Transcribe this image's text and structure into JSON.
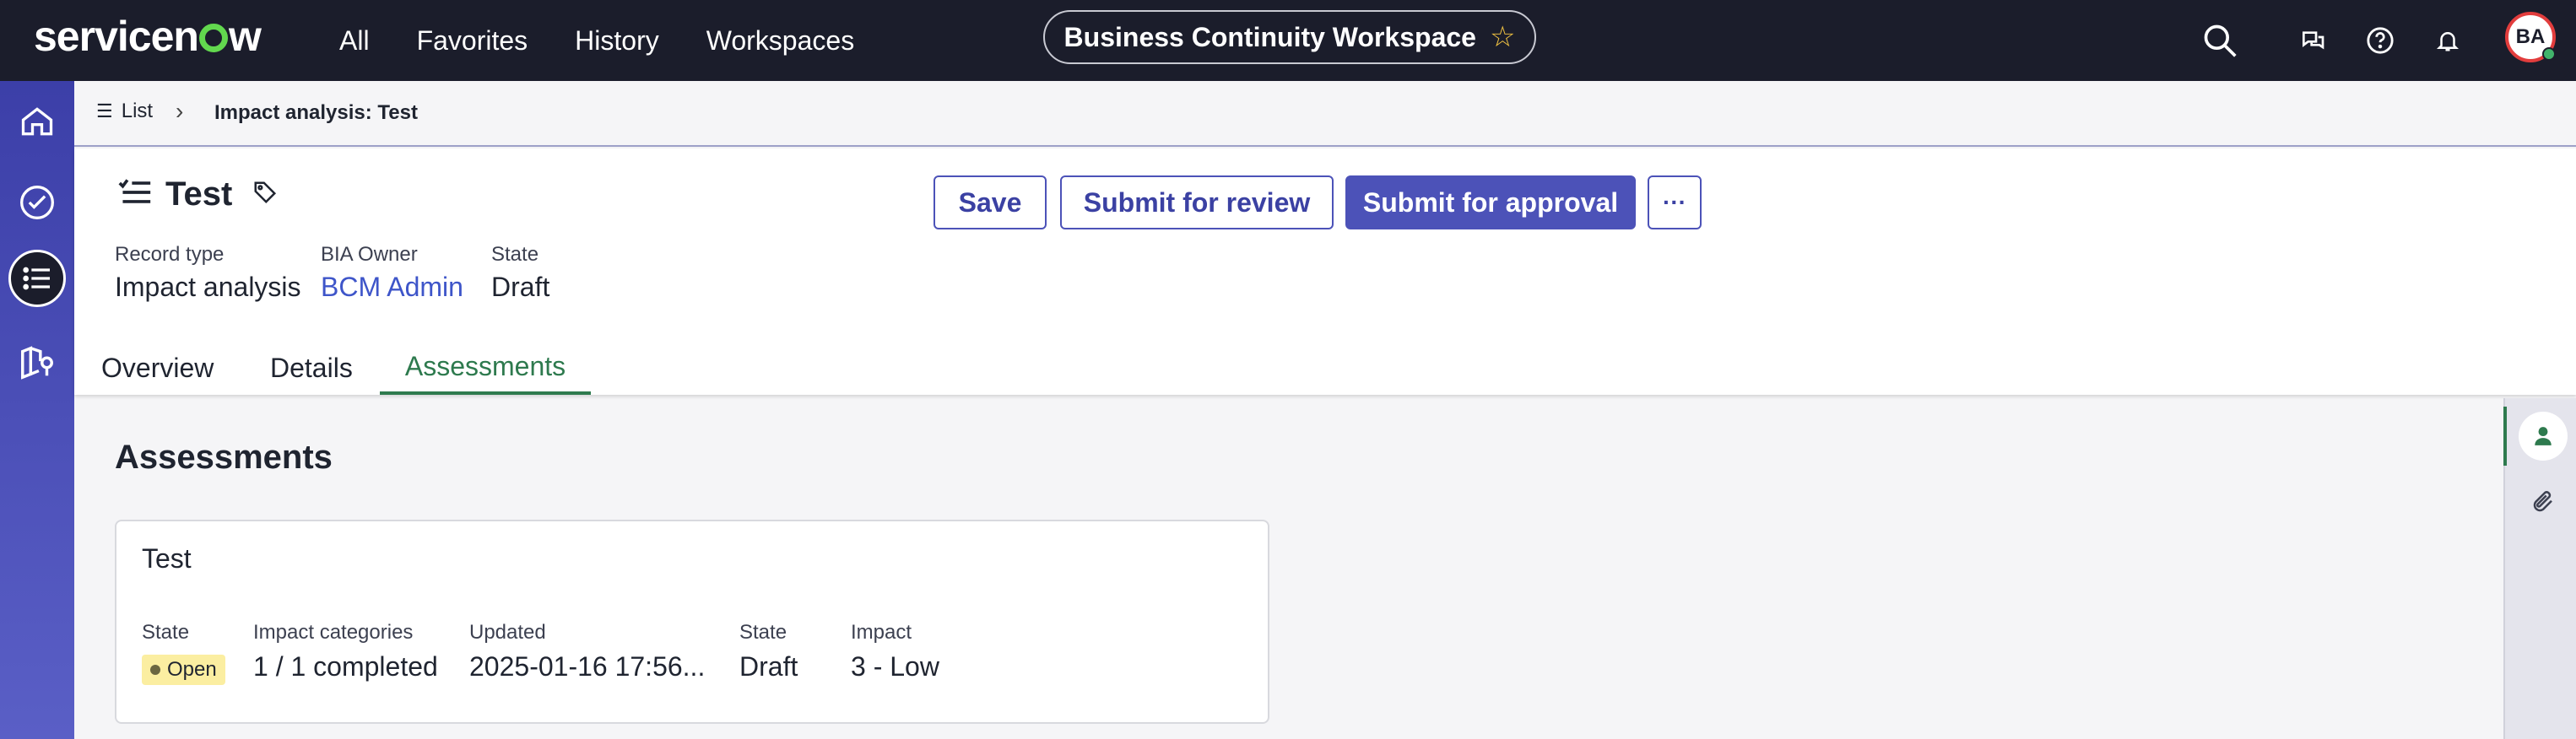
{
  "topnav": {
    "logo_text_a": "servicen",
    "logo_text_b": "w",
    "menu": [
      "All",
      "Favorites",
      "History",
      "Workspaces"
    ],
    "workspace_title": "Business Continuity Workspace",
    "workspace_star": "☆",
    "avatar_initials": "BA"
  },
  "icons": {
    "search": "search-icon",
    "chat": "chat-icon",
    "help": "help-icon",
    "bell": "bell-icon"
  },
  "breadcrumb": {
    "list_label": "List",
    "separator": "›",
    "current": "Impact analysis: Test"
  },
  "record": {
    "title": "Test",
    "meta": [
      {
        "label": "Record type",
        "value": "Impact analysis"
      },
      {
        "label": "BIA Owner",
        "value": "BCM Admin"
      },
      {
        "label": "State",
        "value": "Draft"
      }
    ],
    "buttons": {
      "save": "Save",
      "submit_review": "Submit for review",
      "submit_approval": "Submit for approval",
      "more": "···"
    },
    "tabs": [
      "Overview",
      "Details",
      "Assessments"
    ],
    "active_tab": "Assessments"
  },
  "assessments": {
    "section_title": "Assessments",
    "card": {
      "title": "Test",
      "fields": [
        {
          "label": "State",
          "value": "Open"
        },
        {
          "label": "Impact categories",
          "value": "1 / 1 completed"
        },
        {
          "label": "Updated",
          "value": "2025-01-16 17:56..."
        },
        {
          "label": "State",
          "value": "Draft"
        },
        {
          "label": "Impact",
          "value": "3 - Low"
        }
      ]
    }
  },
  "colors": {
    "topbar": "#1b1d2b",
    "primary": "#4c52b8",
    "active_tab": "#2e7a4e",
    "link": "#3e55c9",
    "badge_open": "#fbeea1"
  }
}
